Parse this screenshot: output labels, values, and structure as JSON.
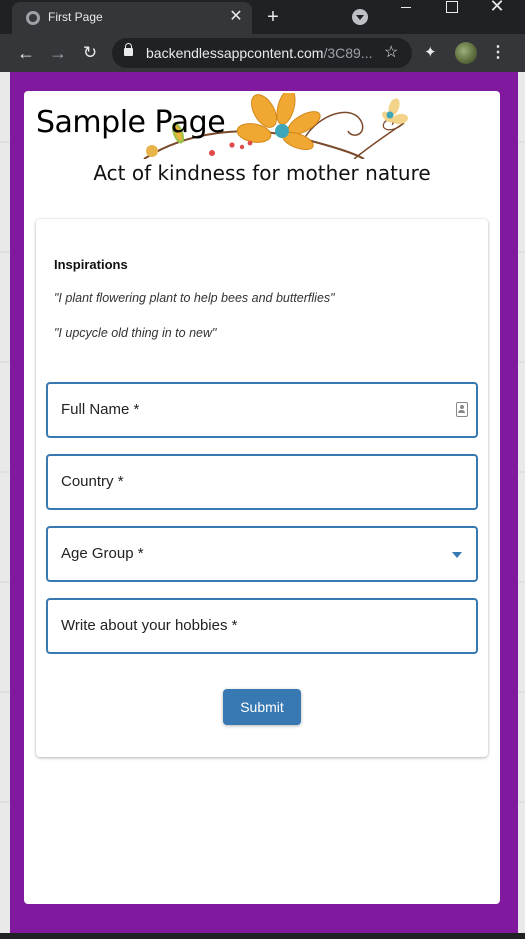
{
  "browser": {
    "tab_title": "First Page",
    "tab_close": "✕",
    "new_tab": "+",
    "url_host": "backendlessappcontent.com",
    "url_path": "/3C89...",
    "star": "☆",
    "extensions": "✦",
    "menu": "⋮",
    "back": "←",
    "forward": "→",
    "reload": "↻",
    "win_close": "✕"
  },
  "page": {
    "title": "Sample Page",
    "subtitle": "Act of kindness for mother nature"
  },
  "inspirations": {
    "heading": "Inspirations",
    "quotes": [
      "\"I plant flowering plant to help bees and butterflies\"",
      "\"I upcycle old thing in to new\""
    ]
  },
  "form": {
    "full_name_label": "Full Name *",
    "country_label": "Country *",
    "age_group_label": "Age Group *",
    "hobbies_label": "Write about your hobbies *",
    "submit_label": "Submit"
  },
  "colors": {
    "page_background": "#81199e",
    "accent": "#3878b3"
  }
}
